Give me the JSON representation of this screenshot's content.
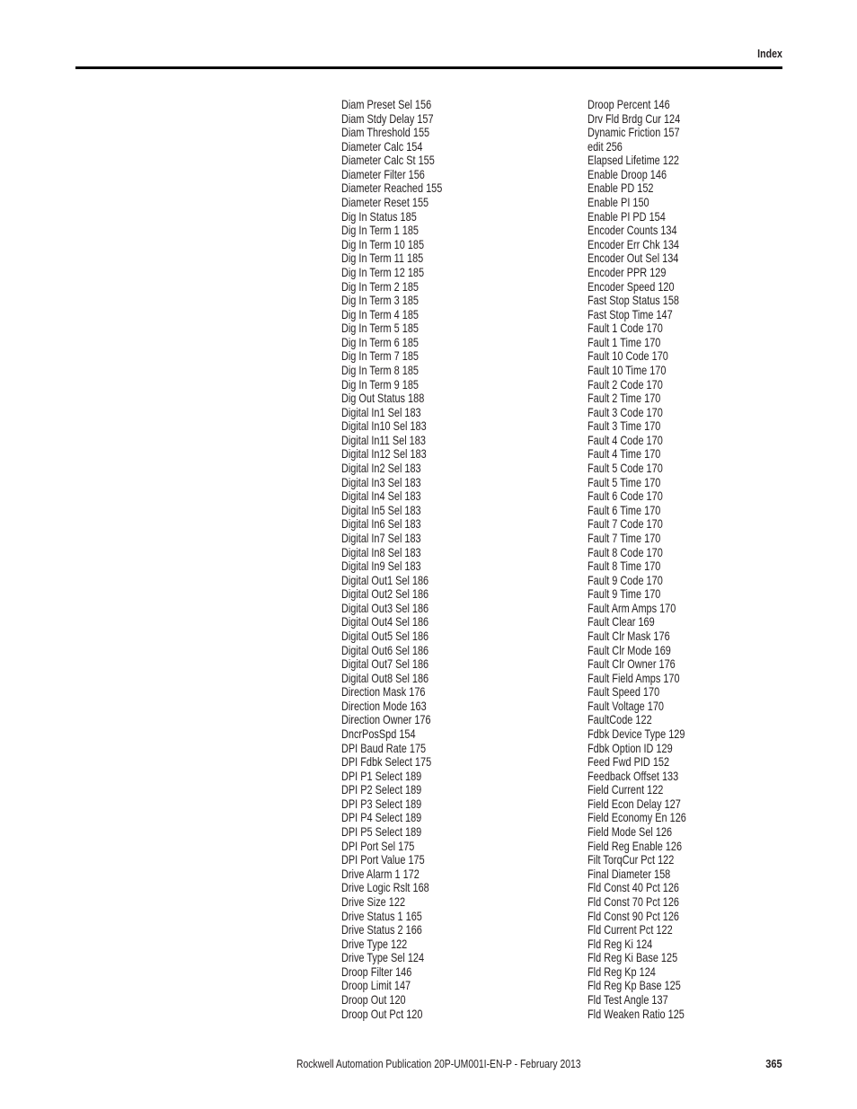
{
  "header": {
    "section_title": "Index"
  },
  "index": {
    "left_column": [
      "Diam Preset Sel 156",
      "Diam Stdy Delay 157",
      "Diam Threshold 155",
      "Diameter Calc 154",
      "Diameter Calc St 155",
      "Diameter Filter 156",
      "Diameter Reached 155",
      "Diameter Reset 155",
      "Dig In Status 185",
      "Dig In Term 1 185",
      "Dig In Term 10 185",
      "Dig In Term 11 185",
      "Dig In Term 12 185",
      "Dig In Term 2 185",
      "Dig In Term 3 185",
      "Dig In Term 4 185",
      "Dig In Term 5 185",
      "Dig In Term 6 185",
      "Dig In Term 7 185",
      "Dig In Term 8 185",
      "Dig In Term 9 185",
      "Dig Out Status 188",
      "Digital In1 Sel 183",
      "Digital In10 Sel 183",
      "Digital In11 Sel 183",
      "Digital In12 Sel 183",
      "Digital In2 Sel 183",
      "Digital In3 Sel 183",
      "Digital In4 Sel 183",
      "Digital In5 Sel 183",
      "Digital In6 Sel 183",
      "Digital In7 Sel 183",
      "Digital In8 Sel 183",
      "Digital In9 Sel 183",
      "Digital Out1 Sel 186",
      "Digital Out2 Sel 186",
      "Digital Out3 Sel 186",
      "Digital Out4 Sel 186",
      "Digital Out5 Sel 186",
      "Digital Out6 Sel 186",
      "Digital Out7 Sel 186",
      "Digital Out8 Sel 186",
      "Direction Mask 176",
      "Direction Mode 163",
      "Direction Owner 176",
      "DncrPosSpd 154",
      "DPI Baud Rate 175",
      "DPI Fdbk Select 175",
      "DPI P1 Select 189",
      "DPI P2 Select 189",
      "DPI P3 Select 189",
      "DPI P4 Select 189",
      "DPI P5 Select 189",
      "DPI Port Sel 175",
      "DPI Port Value 175",
      "Drive Alarm 1 172",
      "Drive Logic Rslt 168",
      "Drive Size 122",
      "Drive Status 1 165",
      "Drive Status 2 166",
      "Drive Type 122",
      "Drive Type Sel 124",
      "Droop Filter 146",
      "Droop Limit 147",
      "Droop Out 120",
      "Droop Out Pct 120"
    ],
    "right_column": [
      "Droop Percent 146",
      "Drv Fld Brdg Cur 124",
      "Dynamic Friction 157",
      "edit 256",
      "Elapsed Lifetime 122",
      "Enable Droop 146",
      "Enable PD 152",
      "Enable PI 150",
      "Enable PI PD 154",
      "Encoder Counts 134",
      "Encoder Err Chk 134",
      "Encoder Out Sel 134",
      "Encoder PPR 129",
      "Encoder Speed 120",
      "Fast Stop Status 158",
      "Fast Stop Time 147",
      "Fault 1 Code 170",
      "Fault 1 Time 170",
      "Fault 10 Code 170",
      "Fault 10 Time 170",
      "Fault 2 Code 170",
      "Fault 2 Time 170",
      "Fault 3 Code 170",
      "Fault 3 Time 170",
      "Fault 4 Code 170",
      "Fault 4 Time 170",
      "Fault 5 Code 170",
      "Fault 5 Time 170",
      "Fault 6 Code 170",
      "Fault 6 Time 170",
      "Fault 7 Code 170",
      "Fault 7 Time 170",
      "Fault 8 Code 170",
      "Fault 8 Time 170",
      "Fault 9 Code 170",
      "Fault 9 Time 170",
      "Fault Arm Amps 170",
      "Fault Clear 169",
      "Fault Clr Mask 176",
      "Fault Clr Mode 169",
      "Fault Clr Owner 176",
      "Fault Field Amps 170",
      "Fault Speed 170",
      "Fault Voltage 170",
      "FaultCode 122",
      "Fdbk Device Type 129",
      "Fdbk Option ID 129",
      "Feed Fwd PID 152",
      "Feedback Offset 133",
      "Field Current 122",
      "Field Econ Delay 127",
      "Field Economy En 126",
      "Field Mode Sel 126",
      "Field Reg Enable 126",
      "Filt TorqCur Pct 122",
      "Final Diameter 158",
      "Fld Const 40 Pct 126",
      "Fld Const 70 Pct 126",
      "Fld Const 90 Pct 126",
      "Fld Current Pct 122",
      "Fld Reg Ki 124",
      "Fld Reg Ki Base 125",
      "Fld Reg Kp 124",
      "Fld Reg Kp Base 125",
      "Fld Test Angle 137",
      "Fld Weaken Ratio 125"
    ]
  },
  "footer": {
    "publication": "Rockwell Automation Publication 20P-UM001I-EN-P - February 2013",
    "page_number": "365"
  }
}
